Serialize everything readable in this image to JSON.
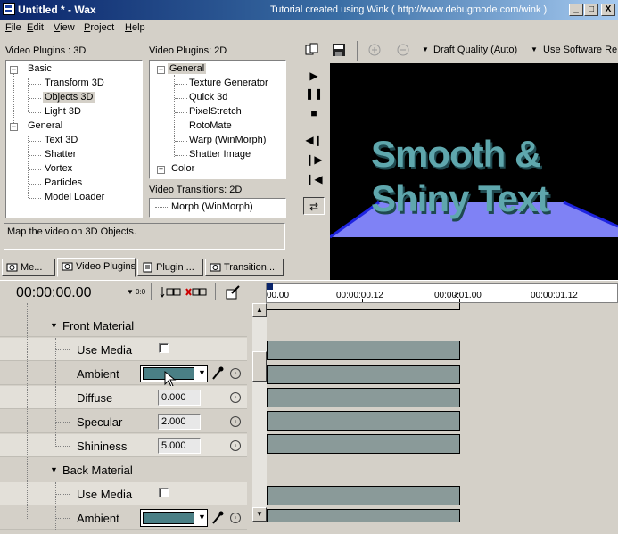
{
  "window": {
    "title": "Untitled * - Wax",
    "tutorial_note": "Tutorial created using Wink ( http://www.debugmode.com/wink )",
    "minimize": "_",
    "maximize": "□",
    "close": "X"
  },
  "menu": [
    "File",
    "Edit",
    "View",
    "Project",
    "Help"
  ],
  "plugins3d": {
    "label": "Video Plugins : 3D",
    "groups": [
      {
        "label": "Basic",
        "items": [
          "Transform 3D",
          "Objects 3D",
          "Light 3D"
        ]
      },
      {
        "label": "General",
        "items": [
          "Text 3D",
          "Shatter",
          "Vortex",
          "Particles",
          "Model Loader"
        ]
      }
    ],
    "selected": "Objects 3D"
  },
  "plugins2d": {
    "label": "Video Plugins: 2D",
    "general": "General",
    "items": [
      "Texture Generator",
      "Quick 3d",
      "PixelStretch",
      "RotoMate",
      "Warp (WinMorph)",
      "Shatter Image"
    ],
    "color": "Color"
  },
  "transitions2d": {
    "label": "Video Transitions: 2D",
    "items": [
      "Morph (WinMorph)"
    ]
  },
  "description": "Map the video on 3D Objects.",
  "tabs": [
    "Me...",
    "Video Plugins",
    "Plugin ...",
    "Transition..."
  ],
  "preview_toolbar": {
    "quality": "Draft Quality (Auto)",
    "renderer": "Use Software Re"
  },
  "preview_text": [
    "Smooth &",
    "Shiny Text"
  ],
  "timeline": {
    "time": "00:00:00.00",
    "step": "0:0",
    "ruler_labels": [
      "00.00",
      "00:00:00.12",
      "00:00:01.00",
      "00:00:01.12"
    ]
  },
  "properties": [
    {
      "type": "section",
      "label": "Front Material"
    },
    {
      "type": "check",
      "label": "Use Media"
    },
    {
      "type": "color",
      "label": "Ambient",
      "color": "#4a7f85"
    },
    {
      "type": "value",
      "label": "Diffuse",
      "value": "0.000"
    },
    {
      "type": "value",
      "label": "Specular",
      "value": "2.000"
    },
    {
      "type": "value",
      "label": "Shininess",
      "value": "5.000"
    },
    {
      "type": "section",
      "label": "Back Material"
    },
    {
      "type": "check",
      "label": "Use Media"
    },
    {
      "type": "color",
      "label": "Ambient",
      "color": "#4a7f85"
    }
  ],
  "colors": {
    "titlebar_start": "#0a246a",
    "track": "#8a9a99",
    "preview_text": "#5fa7ad",
    "floor": "#7f82f5"
  }
}
